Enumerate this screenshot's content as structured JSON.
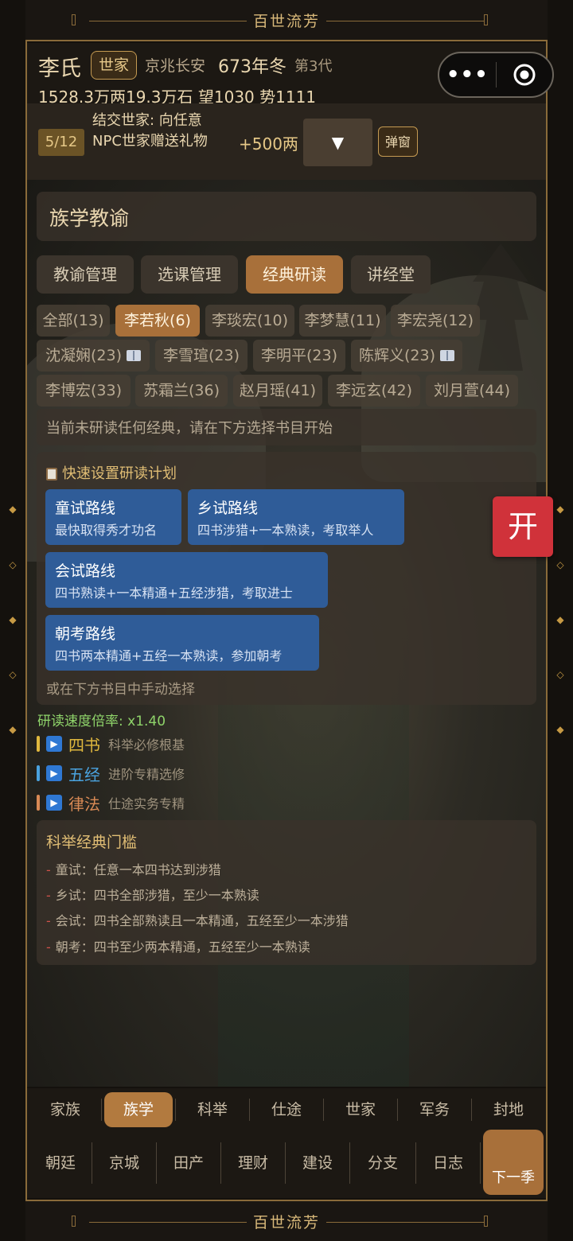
{
  "banner": {
    "title": "百世流芳"
  },
  "header": {
    "clan": "李氏",
    "badge": "世家",
    "location": "京兆长安",
    "season": "673年冬",
    "generation": "第3代",
    "stats": "1528.3万两19.3万石  望1030 势1111",
    "menu_icon": "more-dots-icon",
    "target_icon": "target-icon"
  },
  "task": {
    "progress": "5/12",
    "description": "结交世家: 向任意NPC世家赠送礼物",
    "reward": "+500两",
    "dropdown": "▼",
    "popup": "弹窗"
  },
  "section": {
    "title": "族学教谕",
    "tabs": [
      "教谕管理",
      "选课管理",
      "经典研读",
      "讲经堂"
    ],
    "active_tab": "经典研读"
  },
  "students": [
    "全部(13)",
    "李若秋(6)",
    "李琰宏(10)",
    "李梦慧(11)",
    "李宏尧(12)",
    "沈凝娴(23)",
    "李雪瑄(23)",
    "李明平(23)",
    "陈辉义(23)",
    "李博宏(33)",
    "苏霜兰(36)",
    "赵月瑶(41)",
    "李远玄(42)",
    "刘月萱(44)"
  ],
  "students_active": "李若秋(6)",
  "status_hint": "当前未研读任何经典，请在下方选择书目开始",
  "plan": {
    "title": "快速设置研读计划",
    "routes": [
      {
        "name": "童试路线",
        "desc": "最快取得秀才功名"
      },
      {
        "name": "乡试路线",
        "desc": "四书涉猎+一本熟读，考取举人"
      },
      {
        "name": "会试路线",
        "desc": "四书熟读+一本精通+五经涉猎，考取进士"
      },
      {
        "name": "朝考路线",
        "desc": "四书两本精通+五经一本熟读，参加朝考"
      }
    ],
    "manual": "或在下方书目中手动选择"
  },
  "kai": "开",
  "speed": "研读速度倍率: x1.40",
  "categories": [
    {
      "name": "四书",
      "desc": "科举必修根基",
      "color": "#e0b83e"
    },
    {
      "name": "五经",
      "desc": "进阶专精选修",
      "color": "#4aa3df"
    },
    {
      "name": "律法",
      "desc": "仕途实务专精",
      "color": "#d98a55"
    }
  ],
  "threshold": {
    "title": "科举经典门槛",
    "rows": [
      "童试：任意一本四书达到涉猎",
      "乡试：四书全部涉猎，至少一本熟读",
      "会试：四书全部熟读且一本精通，五经至少一本涉猎",
      "朝考：四书至少两本精通，五经至少一本熟读"
    ]
  },
  "nav_primary": [
    "家族",
    "族学",
    "科举",
    "仕途",
    "世家",
    "军务",
    "封地"
  ],
  "nav_primary_active": "族学",
  "nav_secondary": [
    "朝廷",
    "京城",
    "田产",
    "理财",
    "建设",
    "分支",
    "日志"
  ],
  "next_button": "下一季"
}
